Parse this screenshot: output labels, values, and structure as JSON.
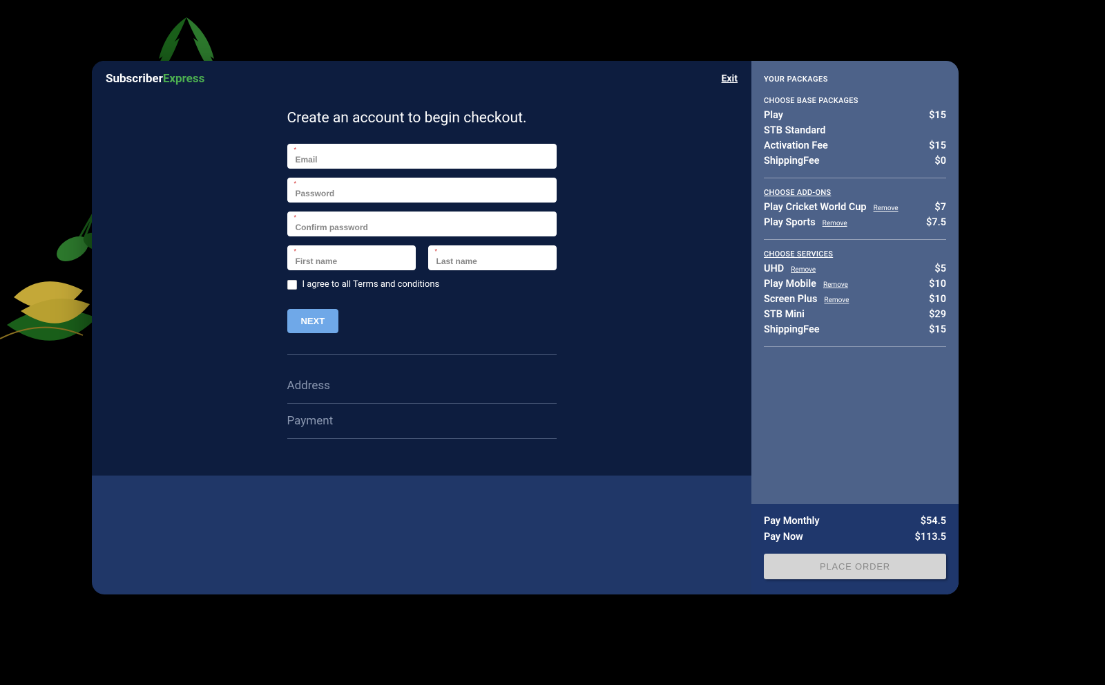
{
  "logo": {
    "part1": "Subscriber",
    "part2": "Express"
  },
  "header": {
    "exit": "Exit"
  },
  "form": {
    "title": "Create an account to begin checkout.",
    "email_placeholder": "Email",
    "password_placeholder": "Password",
    "confirm_password_placeholder": "Confirm password",
    "first_name_placeholder": "First name",
    "last_name_placeholder": "Last name",
    "terms_label": "I agree to all Terms and conditions",
    "next_button": "NEXT"
  },
  "steps": {
    "address": "Address",
    "payment": "Payment"
  },
  "sidebar": {
    "heading": "YOUR PACKAGES",
    "base_label": "CHOOSE BASE PACKAGES",
    "addons_label": "CHOOSE ADD-ONS",
    "services_label": "CHOOSE SERVICES",
    "remove_label": "Remove",
    "base_items": [
      {
        "name": "Play",
        "price": "$15"
      },
      {
        "name": "STB Standard",
        "price": ""
      },
      {
        "name": "Activation Fee",
        "price": "$15"
      },
      {
        "name": "ShippingFee",
        "price": "$0"
      }
    ],
    "addon_items": [
      {
        "name": "Play Cricket World Cup",
        "price": "$7",
        "removable": true
      },
      {
        "name": "Play Sports",
        "price": "$7.5",
        "removable": true
      }
    ],
    "service_items": [
      {
        "name": "UHD",
        "price": "$5",
        "removable": true
      },
      {
        "name": "Play Mobile",
        "price": "$10",
        "removable": true
      },
      {
        "name": "Screen Plus",
        "price": "$10",
        "removable": true
      },
      {
        "name": "STB Mini",
        "price": "$29",
        "removable": false
      },
      {
        "name": "ShippingFee",
        "price": "$15",
        "removable": false
      }
    ]
  },
  "summary": {
    "monthly_label": "Pay Monthly",
    "monthly_value": "$54.5",
    "now_label": "Pay Now",
    "now_value": "$113.5",
    "place_order": "PLACE ORDER"
  }
}
